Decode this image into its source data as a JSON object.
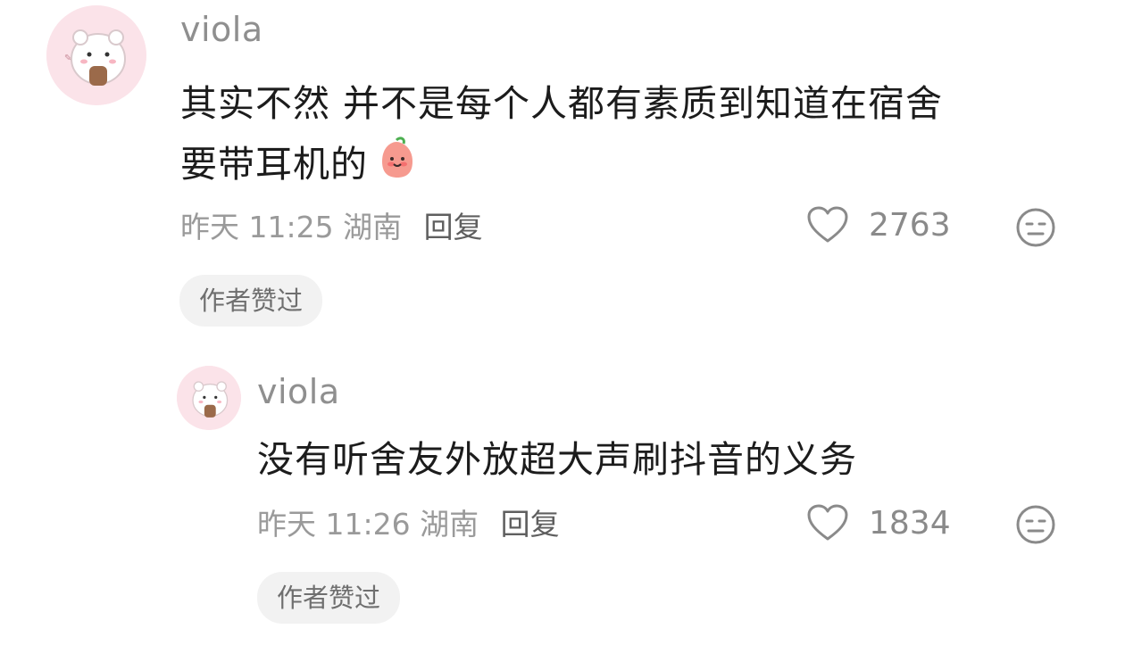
{
  "comments": [
    {
      "username": "viola",
      "text_line1": "其实不然 并不是每个人都有素质到知道在宿舍",
      "text_line2": "要带耳机的",
      "time": "昨天 11:25",
      "location": "湖南",
      "reply_label": "回复",
      "likes": "2763",
      "badge": "作者赞过",
      "emoji_icon": "peach-face-emoji-icon"
    },
    {
      "username": "viola",
      "text": "没有听舍友外放超大声刷抖音的义务",
      "time": "昨天 11:26",
      "location": "湖南",
      "reply_label": "回复",
      "likes": "1834",
      "badge": "作者赞过"
    }
  ]
}
